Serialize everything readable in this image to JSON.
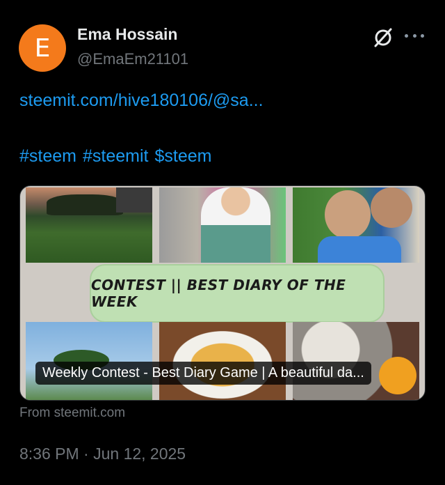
{
  "author": {
    "avatar_letter": "E",
    "avatar_color": "#f47a1b",
    "display_name": "Ema Hossain",
    "handle": "@EmaEm21101"
  },
  "header_icons": [
    "grok-icon",
    "more-options-icon"
  ],
  "post": {
    "link_text": "steemit.com/hive180106/@sa...",
    "hashtags": [
      "#steem",
      "#steemit",
      "$steem"
    ]
  },
  "card": {
    "banner_text": "CONTEST || BEST DIARY OF THE WEEK",
    "caption": "Weekly Contest - Best Diary Game | A beautiful da...",
    "source": "From steemit.com"
  },
  "timestamp": "8:36 PM · Jun 12, 2025",
  "colors": {
    "background": "#000000",
    "link": "#1d9bf0",
    "secondary_text": "#71767b",
    "banner_bg": "#bfe0b3"
  }
}
